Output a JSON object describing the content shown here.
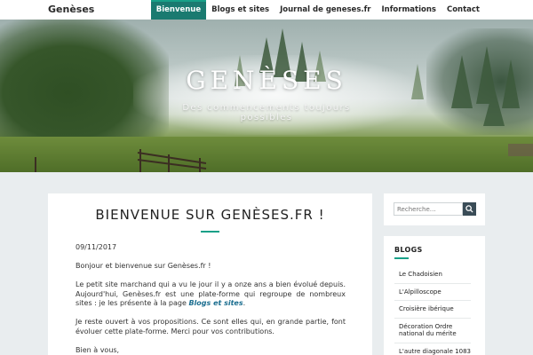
{
  "header": {
    "brand": "Genèses",
    "nav": [
      {
        "label": "Bienvenue",
        "active": true
      },
      {
        "label": "Blogs et sites",
        "active": false
      },
      {
        "label": "Journal de geneses.fr",
        "active": false
      },
      {
        "label": "Informations",
        "active": false
      },
      {
        "label": "Contact",
        "active": false
      }
    ]
  },
  "hero": {
    "title": "GENÈSES",
    "subtitle": "Des commencements toujours possibles"
  },
  "post": {
    "title": "BIENVENUE SUR GENÈSES.FR !",
    "date": "09/11/2017",
    "p1": "Bonjour et bienvenue sur Genèses.fr !",
    "p2_before": "Le petit site marchand qui a vu le jour il y a onze ans a bien évolué depuis. Aujourd'hui, Genèses.fr est une plate-forme qui regroupe de nombreux sites : je les présente à la page ",
    "p2_link": "Blogs et sites",
    "p2_after": ".",
    "p3": "Je reste ouvert à vos propositions. Ce sont elles qui, en grande partie, font évoluer cette plate-forme. Merci pour vos contributions.",
    "p4": "Bien à vous,"
  },
  "sidebar": {
    "search_placeholder": "Recherche…",
    "blogs_title": "BLOGS",
    "blogs": [
      "Le Chadoisien",
      "L'Alpilloscope",
      "Croisière ibérique",
      "Décoration Ordre national du mérite",
      "L'autre diagonale 1083"
    ]
  },
  "colors": {
    "accent": "#17a088",
    "nav_active_bg": "#1a7a70",
    "link": "#1a6d8f",
    "search_button": "#3a4c57"
  },
  "icons": {
    "search_button": "search-icon"
  }
}
